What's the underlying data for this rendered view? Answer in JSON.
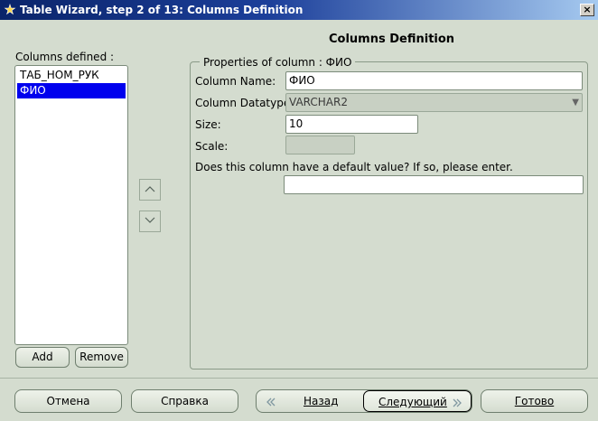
{
  "window": {
    "title": "Table Wizard, step 2 of 13: Columns Definition",
    "close_glyph": "×"
  },
  "heading": "Columns Definition",
  "columns_panel": {
    "label": "Columns defined :",
    "items": [
      "ТАБ_НОМ_РУК",
      "ФИО"
    ],
    "selected_index": 1,
    "add_label": "Add",
    "remove_label": "Remove"
  },
  "properties": {
    "legend": "Properties of column : ФИО",
    "column_name_label": "Column Name:",
    "column_name_value": "ФИО",
    "datatype_label": "Column Datatype:",
    "datatype_value": "VARCHAR2",
    "size_label": "Size:",
    "size_value": "10",
    "scale_label": "Scale:",
    "scale_value": "",
    "default_prompt": "Does this column have a default value? If so, please enter.",
    "default_value": ""
  },
  "icons": {
    "app": "wizard-icon",
    "move_up": "chevron-up-icon",
    "move_down": "chevron-down-icon",
    "back": "double-chevron-left-icon",
    "next": "double-chevron-right-icon"
  },
  "footer": {
    "cancel_label": "Отмена",
    "help_label": "Справка",
    "back_label": "Назад",
    "next_label": "Следующий",
    "finish_label": "Готово"
  },
  "colors": {
    "title_start": "#0a246a",
    "title_end": "#a6caf0",
    "selection": "#0000ee",
    "background": "#d4dccf"
  }
}
